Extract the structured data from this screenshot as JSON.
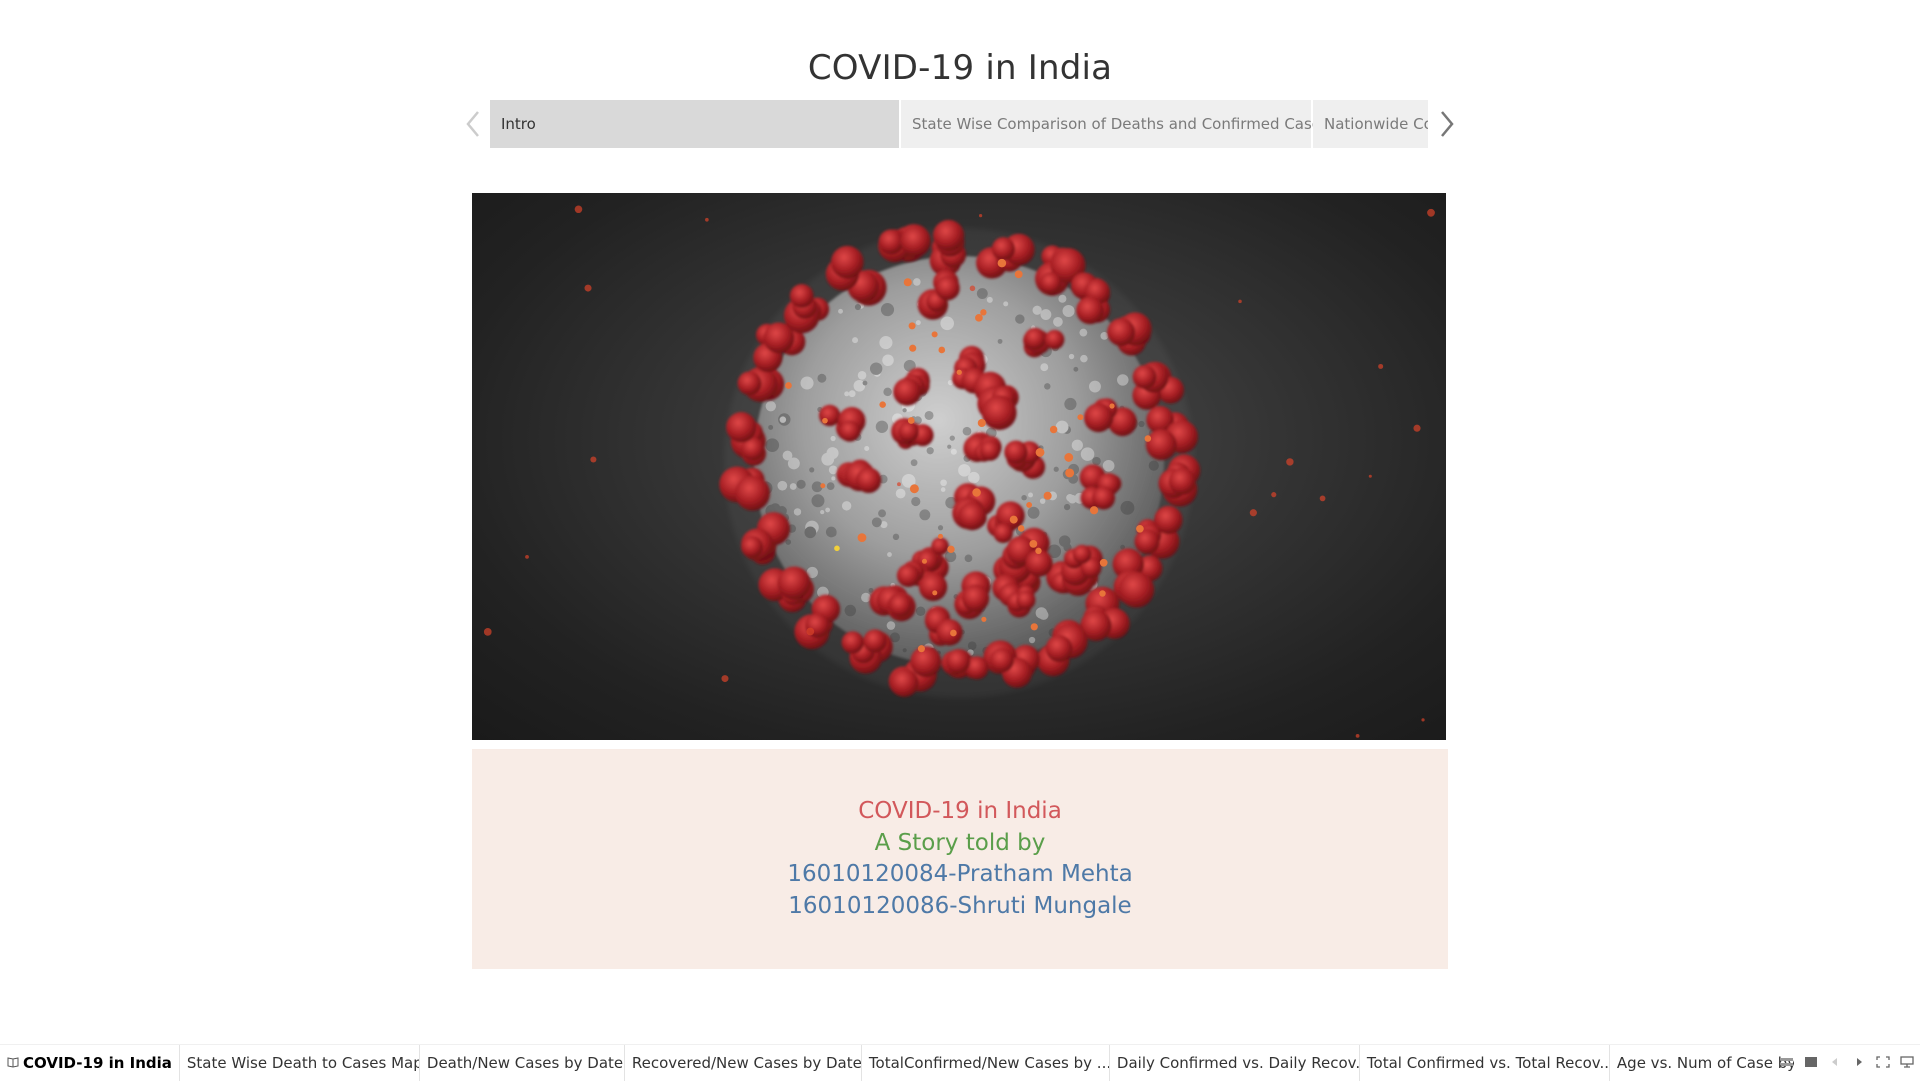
{
  "story": {
    "title": "COVID-19 in India",
    "points": [
      {
        "label": "Intro",
        "active": true
      },
      {
        "label": "State Wise Comparison of Deaths and Confirmed Cases",
        "active": false
      },
      {
        "label": "Nationwide Cor",
        "active": false
      }
    ],
    "nav": {
      "prev_icon": "chevron-left-icon",
      "next_icon": "chevron-right-icon"
    }
  },
  "hero_image": {
    "subject": "coronavirus-illustration"
  },
  "caption": {
    "line1": "COVID-19 in India",
    "line2": "A Story told by",
    "line3": "16010120084-Pratham Mehta",
    "line4": "16010120086-Shruti Mungale",
    "colors": {
      "line1": "#d2585b",
      "line2": "#5a9e4a",
      "line3": "#4e79a7",
      "background": "#f8ece6"
    }
  },
  "tabs": [
    {
      "label": "COVID-19 in India",
      "active": true,
      "icon": "story-book-icon"
    },
    {
      "label": "State Wise Death to Cases Map"
    },
    {
      "label": "Death/New Cases by Date"
    },
    {
      "label": "Recovered/New Cases by Date"
    },
    {
      "label": "TotalConfirmed/New Cases by ..."
    },
    {
      "label": "Daily Confirmed vs. Daily Recov..."
    },
    {
      "label": "Total Confirmed vs. Total Recov..."
    },
    {
      "label": "Age vs. Num of Case by Ge"
    }
  ],
  "tab_controls": [
    "sheet-list-icon",
    "filmstrip-icon",
    "scroll-left-icon",
    "scroll-right-icon",
    "fullscreen-icon",
    "presentation-icon"
  ]
}
